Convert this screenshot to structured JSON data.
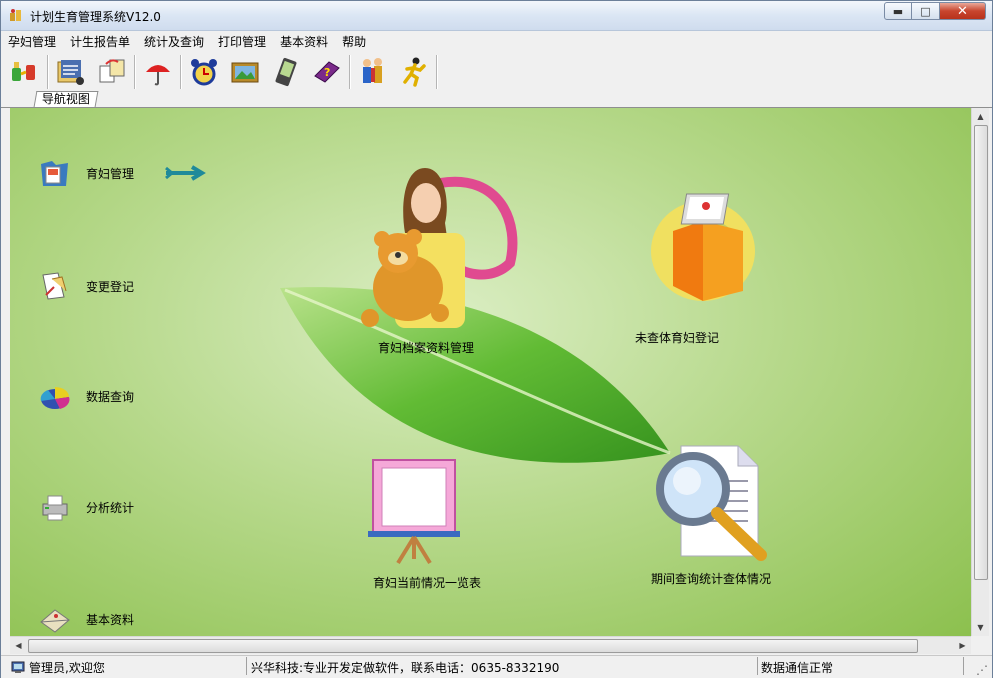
{
  "window": {
    "title": "计划生育管理系统V12.0",
    "minimize_glyph": "0",
    "maximize_glyph": "1",
    "close_glyph": "r"
  },
  "menu": [
    "孕妇管理",
    "计生报告单",
    "统计及查询",
    "打印管理",
    "基本资料",
    "帮助"
  ],
  "toolbar": {
    "icons": [
      "connect-icon",
      "records-icon",
      "transfer-icon",
      "umbrella-icon",
      "alarm-clock-icon",
      "picture-icon",
      "pda-icon",
      "help-book-icon",
      "users-icon",
      "exit-runner-icon"
    ]
  },
  "tab": {
    "label": "导航视图"
  },
  "nav": {
    "items": [
      {
        "label": "育妇管理",
        "icon": "folder-icon"
      },
      {
        "label": "变更登记",
        "icon": "document-edit-icon"
      },
      {
        "label": "数据查询",
        "icon": "pie-chart-icon"
      },
      {
        "label": "分析统计",
        "icon": "printer-icon"
      },
      {
        "label": "基本资料",
        "icon": "envelope-icon"
      }
    ],
    "arrow_icon": "arrow-right-icon"
  },
  "features": [
    {
      "label": "育妇档案资料管理",
      "icon": "mother-bear-icon"
    },
    {
      "label": "未查体育妇登记",
      "icon": "laptop-book-icon"
    },
    {
      "label": "育妇当前情况一览表",
      "icon": "easel-board-icon"
    },
    {
      "label": "期间查询统计查体情况",
      "icon": "magnifier-document-icon"
    }
  ],
  "status": {
    "user": "管理员,欢迎您",
    "company": "兴华科技:专业开发定做软件，联系电话：0635-8332190",
    "connection": "数据通信正常"
  }
}
